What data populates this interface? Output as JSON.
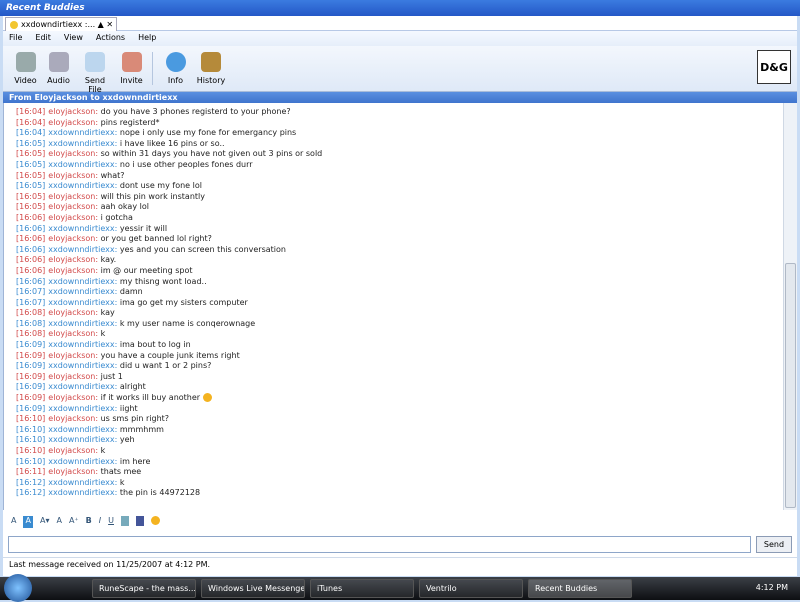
{
  "window": {
    "title": "Recent Buddies",
    "tab": "xxdowndirtiexx :...",
    "conversation_header": "From Eloyjackson to xxdownndirtiexx"
  },
  "menu": [
    "File",
    "Edit",
    "View",
    "Actions",
    "Help"
  ],
  "toolbar": [
    "Video",
    "Audio",
    "Send File",
    "Invite",
    "Info",
    "History"
  ],
  "logo": "D&G",
  "messages": [
    {
      "t": "[16:04]",
      "s": "eloyjackson:",
      "m": "do you have 3 phones registerd to your phone?",
      "b": 0
    },
    {
      "t": "[16:04]",
      "s": "eloyjackson:",
      "m": "pins registerd*",
      "b": 0
    },
    {
      "t": "[16:04]",
      "s": "xxdownndirtiexx:",
      "m": "nope i only use my fone for emergancy pins",
      "b": 1
    },
    {
      "t": "[16:05]",
      "s": "xxdownndirtiexx:",
      "m": "i have likee 16 pins or so..",
      "b": 1
    },
    {
      "t": "[16:05]",
      "s": "eloyjackson:",
      "m": "so within 31 days you have not given out 3 pins or sold",
      "b": 0
    },
    {
      "t": "[16:05]",
      "s": "xxdownndirtiexx:",
      "m": "no i use other peoples fones durr",
      "b": 1
    },
    {
      "t": "[16:05]",
      "s": "eloyjackson:",
      "m": "what?",
      "b": 0
    },
    {
      "t": "[16:05]",
      "s": "xxdownndirtiexx:",
      "m": "dont use my fone lol",
      "b": 1
    },
    {
      "t": "[16:05]",
      "s": "eloyjackson:",
      "m": "will this pin work instantly",
      "b": 0
    },
    {
      "t": "[16:05]",
      "s": "eloyjackson:",
      "m": "aah okay lol",
      "b": 0
    },
    {
      "t": "[16:06]",
      "s": "eloyjackson:",
      "m": "i gotcha",
      "b": 0
    },
    {
      "t": "[16:06]",
      "s": "xxdownndirtiexx:",
      "m": "yessir it will",
      "b": 1
    },
    {
      "t": "[16:06]",
      "s": "eloyjackson:",
      "m": "or you get banned lol right?",
      "b": 0
    },
    {
      "t": "[16:06]",
      "s": "xxdownndirtiexx:",
      "m": "yes and you can screen this conversation",
      "b": 1
    },
    {
      "t": "[16:06]",
      "s": "eloyjackson:",
      "m": "kay.",
      "b": 0
    },
    {
      "t": "[16:06]",
      "s": "eloyjackson:",
      "m": "im @ our meeting spot",
      "b": 0
    },
    {
      "t": "[16:06]",
      "s": "xxdownndirtiexx:",
      "m": "my thisng wont load..",
      "b": 1
    },
    {
      "t": "[16:07]",
      "s": "xxdownndirtiexx:",
      "m": "damn",
      "b": 1
    },
    {
      "t": "[16:07]",
      "s": "xxdownndirtiexx:",
      "m": " ima go get my sisters computer",
      "b": 1
    },
    {
      "t": "[16:08]",
      "s": "eloyjackson:",
      "m": "kay",
      "b": 0
    },
    {
      "t": "[16:08]",
      "s": "xxdownndirtiexx:",
      "m": "k my user name is conqerownage",
      "b": 1
    },
    {
      "t": "[16:08]",
      "s": "eloyjackson:",
      "m": "k",
      "b": 0
    },
    {
      "t": "[16:09]",
      "s": "xxdownndirtiexx:",
      "m": "ima bout to log in",
      "b": 1
    },
    {
      "t": "[16:09]",
      "s": "eloyjackson:",
      "m": "you have a couple junk items right",
      "b": 0
    },
    {
      "t": "[16:09]",
      "s": "xxdownndirtiexx:",
      "m": "did u want 1 or 2 pins?",
      "b": 1
    },
    {
      "t": "[16:09]",
      "s": "eloyjackson:",
      "m": "just 1",
      "b": 0
    },
    {
      "t": "[16:09]",
      "s": "xxdownndirtiexx:",
      "m": "alright",
      "b": 1
    },
    {
      "t": "[16:09]",
      "s": "eloyjackson:",
      "m": "if it works ill buy another",
      "b": 0,
      "smiley": 1
    },
    {
      "t": "[16:09]",
      "s": "xxdownndirtiexx:",
      "m": "iight",
      "b": 1
    },
    {
      "t": "[16:10]",
      "s": "eloyjackson:",
      "m": "us sms pin right?",
      "b": 0
    },
    {
      "t": "[16:10]",
      "s": "xxdownndirtiexx:",
      "m": "mmmhmm",
      "b": 1
    },
    {
      "t": "[16:10]",
      "s": "xxdownndirtiexx:",
      "m": "yeh",
      "b": 1
    },
    {
      "t": "[16:10]",
      "s": "eloyjackson:",
      "m": "k",
      "b": 0
    },
    {
      "t": "[16:10]",
      "s": "xxdownndirtiexx:",
      "m": "im here",
      "b": 1
    },
    {
      "t": "[16:11]",
      "s": "eloyjackson:",
      "m": "thats mee",
      "b": 0
    },
    {
      "t": "[16:12]",
      "s": "xxdownndirtiexx:",
      "m": "k",
      "b": 1
    },
    {
      "t": "[16:12]",
      "s": "xxdownndirtiexx:",
      "m": "the pin is 44972128",
      "b": 1
    }
  ],
  "format_bar": [
    "A",
    "A",
    "A▾",
    "A",
    "A⁺",
    "B",
    "I",
    "U"
  ],
  "input": {
    "value": "",
    "send_label": "Send"
  },
  "status": "Last message received on 11/25/2007 at 4:12 PM.",
  "taskbar": {
    "items": [
      "RuneScape - the mass...",
      "Windows Live Messenger",
      "iTunes",
      "Ventrilo",
      "Recent Buddies"
    ],
    "clock": "4:12 PM"
  }
}
